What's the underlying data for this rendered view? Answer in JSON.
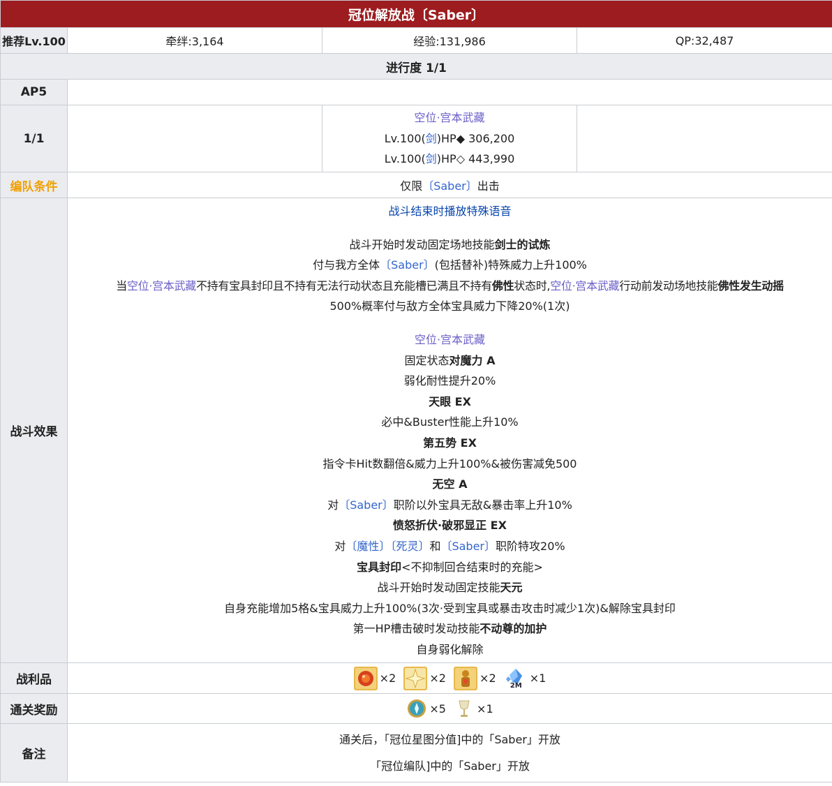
{
  "title": "冠位解放战〔Saber〕",
  "header": {
    "rec_label": "推荐Lv.100",
    "bond": "牵绊:3,164",
    "exp": "经验:131,986",
    "qp": "QP:32,487"
  },
  "progress": "进行度 1/1",
  "ap_label": "AP5",
  "wave": {
    "label": "1/1",
    "enemy_name": "空位·宫本武藏",
    "hp1_pre": "Lv.100(",
    "hp1_class": "剑",
    "hp1_post": ")HP◆ 306,200",
    "hp2_pre": "Lv.100(",
    "hp2_class": "剑",
    "hp2_post": ")HP◇ 443,990"
  },
  "formation": {
    "label": "编队条件",
    "pre": "仅限",
    "cls": "〔Saber〕",
    "post": "出击"
  },
  "effects": {
    "label": "战斗效果",
    "special_voice": "战斗结束时播放特殊语音",
    "l1_pre": "战斗开始时发动固定场地技能",
    "l1_bold": "剑士的试炼",
    "l2_pre": "付与我方全体",
    "l2_cls": "〔Saber〕",
    "l2_post": "(包括替补)特殊威力上升100%",
    "l3_a": "当",
    "l3_name1": "空位·宫本武藏",
    "l3_b": "不持有宝具封印且不持有无法行动状态且充能槽已满且不持有",
    "l3_bold1": "佛性",
    "l3_c": "状态时,",
    "l3_name2": "空位·宫本武藏",
    "l3_d": "行动前发动场地技能",
    "l3_bold2": "佛性发生动摇",
    "l4": "500%概率付与敌方全体宝具威力下降20%(1次)",
    "enemy_name": "空位·宫本武藏",
    "s1_pre": "固定状态",
    "s1_bold": "对魔力 A",
    "s1_desc": "弱化耐性提升20%",
    "s2_bold": "天眼 EX",
    "s2_desc": "必中&Buster性能上升10%",
    "s3_bold": "第五势 EX",
    "s3_desc": "指令卡Hit数翻倍&威力上升100%&被伤害减免500",
    "s4_bold": "无空 A",
    "s4_pre": "对",
    "s4_cls": "〔Saber〕",
    "s4_post": "职阶以外宝具无敌&暴击率上升10%",
    "s5_bold": "愤怒折伏·破邪显正 EX",
    "s5_pre": "对",
    "s5_c1": "〔魔性〕",
    "s5_c2": "〔死灵〕",
    "s5_and": "和",
    "s5_c3": "〔Saber〕",
    "s5_post": "职阶特攻20%",
    "s6_bold": "宝具封印",
    "s6_post": "<不抑制回合结束时的充能>",
    "s7_pre": "战斗开始时发动固定技能",
    "s7_bold": "天元",
    "s7_desc": "自身充能增加5格&宝具威力上升100%(3次·受到宝具或暴击攻击时减少1次)&解除宝具封印",
    "s8_pre": "第一HP槽击破时发动技能",
    "s8_bold": "不动尊的加护",
    "s8_desc": "自身弱化解除"
  },
  "drops": {
    "label": "战利品",
    "items": [
      {
        "icon": "red-gem-icon",
        "count": "×2"
      },
      {
        "icon": "gold-star-icon",
        "count": "×2"
      },
      {
        "icon": "gold-statue-icon",
        "count": "×2"
      },
      {
        "icon": "blue-crystal-icon",
        "count": "×1",
        "tag": "2M"
      }
    ]
  },
  "rewards": {
    "label": "通关奖励",
    "items": [
      {
        "icon": "saint-quartz-icon",
        "count": "×5"
      },
      {
        "icon": "holy-grail-icon",
        "count": "×1"
      }
    ]
  },
  "notes": {
    "label": "备注",
    "line1": "通关后，「冠位星图分值]中的「Saber」开放",
    "line2": "「冠位编队]中的「Saber」开放"
  },
  "colors": {
    "title_bg": "#9d1c1f",
    "header_bg": "#eaecf0",
    "orange": "#f0a000",
    "link": "#3366cc",
    "purple": "#6a5fc7",
    "blue": "#0645ad"
  }
}
